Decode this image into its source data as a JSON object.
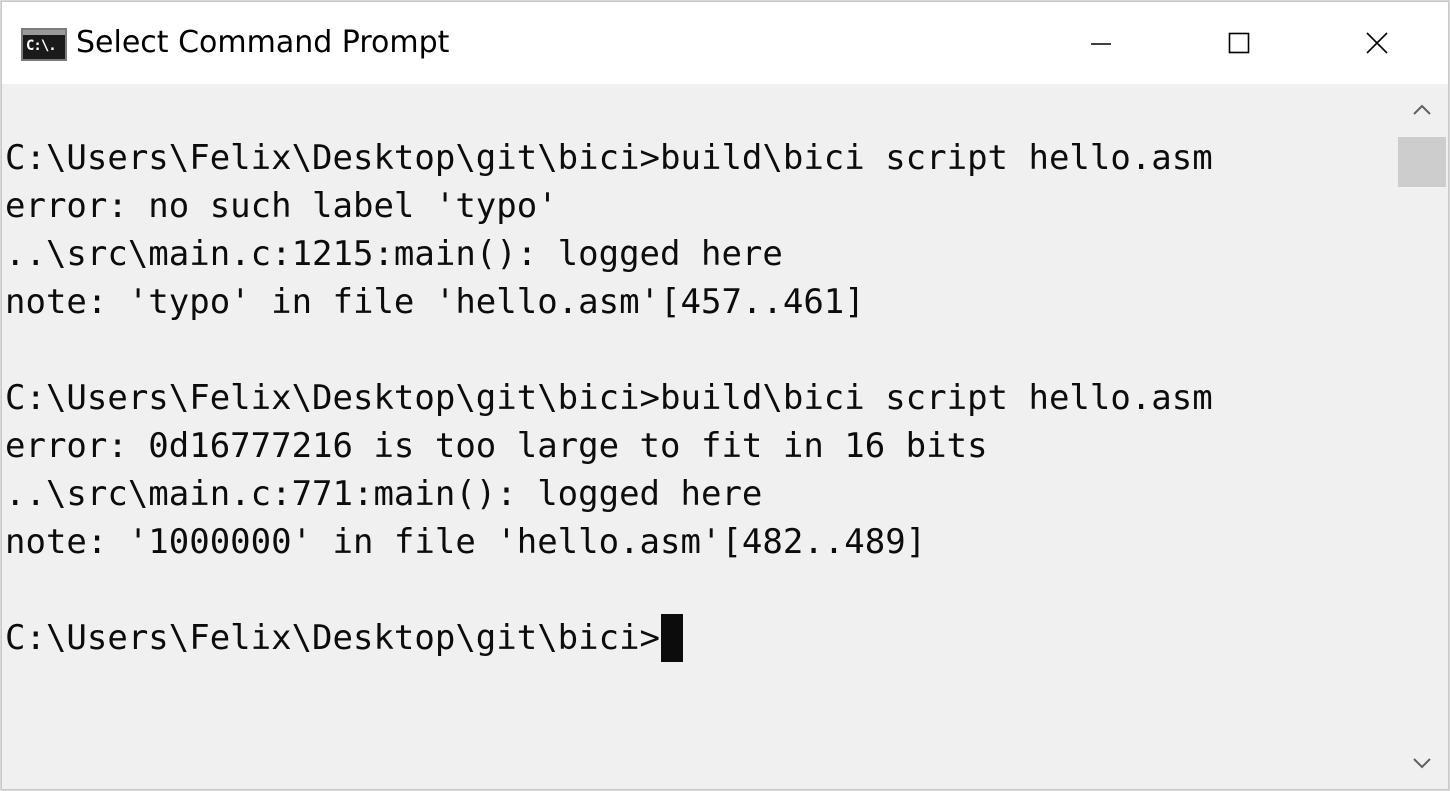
{
  "window": {
    "title": "Select Command Prompt",
    "app_icon": "cmd-icon",
    "app_icon_glyph": "C:\\."
  },
  "caption_buttons": {
    "minimize_icon": "minimize-icon",
    "maximize_icon": "maximize-icon",
    "close_icon": "close-icon"
  },
  "console": {
    "lines": [
      "",
      "C:\\Users\\Felix\\Desktop\\git\\bici>build\\bici script hello.asm",
      "error: no such label 'typo'",
      "..\\src\\main.c:1215:main(): logged here",
      "note: 'typo' in file 'hello.asm'[457..461]",
      "",
      "C:\\Users\\Felix\\Desktop\\git\\bici>build\\bici script hello.asm",
      "error: 0d16777216 is too large to fit in 16 bits",
      "..\\src\\main.c:771:main(): logged here",
      "note: '1000000' in file 'hello.asm'[482..489]",
      ""
    ],
    "prompt": "C:\\Users\\Felix\\Desktop\\git\\bici>",
    "text_color": "#0c0c0c",
    "background_color": "#f0f0f0"
  },
  "scrollbar": {
    "up_icon": "chevron-up-icon",
    "down_icon": "chevron-down-icon"
  }
}
